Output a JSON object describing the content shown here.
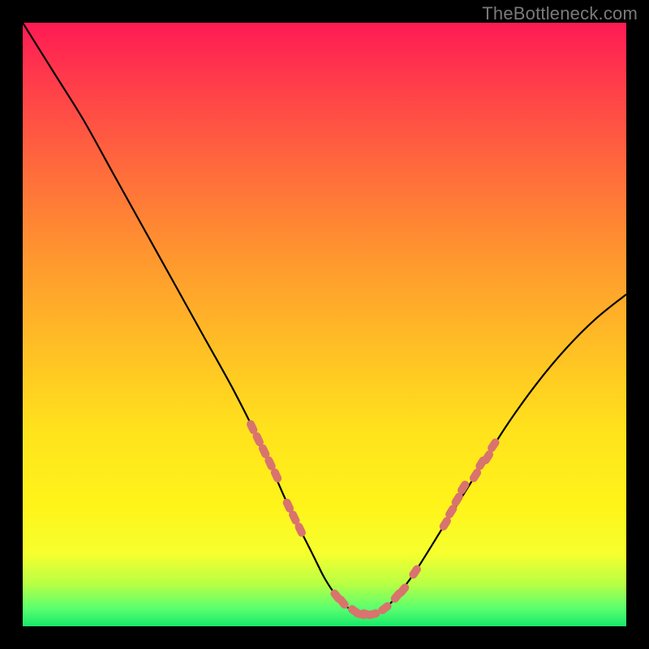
{
  "watermark": {
    "text": "TheBottleneck.com"
  },
  "colors": {
    "frame": "#000000",
    "curve": "#000000",
    "marker": "#d9736e",
    "gradient_top": "#ff1a54",
    "gradient_mid": "#ffe31c",
    "gradient_bottom": "#18e86a"
  },
  "chart_data": {
    "type": "line",
    "title": "",
    "xlabel": "",
    "ylabel": "",
    "xlim": [
      0,
      100
    ],
    "ylim": [
      0,
      100
    ],
    "grid": false,
    "legend": false,
    "series": [
      {
        "name": "bottleneck-curve",
        "x": [
          0,
          5,
          10,
          15,
          20,
          25,
          30,
          35,
          40,
          44,
          48,
          50,
          52,
          54,
          56,
          58,
          60,
          62,
          65,
          70,
          75,
          80,
          85,
          90,
          95,
          100
        ],
        "values": [
          100,
          92,
          84,
          75,
          66,
          57,
          48,
          39,
          29,
          20,
          12,
          8,
          5,
          3,
          2,
          2,
          3,
          5,
          9,
          17,
          25,
          33,
          40,
          46,
          51,
          55
        ]
      }
    ],
    "markers": [
      {
        "x": 38,
        "y": 33
      },
      {
        "x": 39,
        "y": 31
      },
      {
        "x": 40,
        "y": 29
      },
      {
        "x": 41,
        "y": 27
      },
      {
        "x": 42,
        "y": 25
      },
      {
        "x": 44,
        "y": 20
      },
      {
        "x": 45,
        "y": 18
      },
      {
        "x": 46,
        "y": 16
      },
      {
        "x": 52,
        "y": 5
      },
      {
        "x": 53,
        "y": 4
      },
      {
        "x": 55,
        "y": 2.5
      },
      {
        "x": 56,
        "y": 2
      },
      {
        "x": 57,
        "y": 2
      },
      {
        "x": 58,
        "y": 2
      },
      {
        "x": 60,
        "y": 3
      },
      {
        "x": 62,
        "y": 5
      },
      {
        "x": 63,
        "y": 6
      },
      {
        "x": 65,
        "y": 9
      },
      {
        "x": 70,
        "y": 17
      },
      {
        "x": 71,
        "y": 19
      },
      {
        "x": 72,
        "y": 21
      },
      {
        "x": 73,
        "y": 23
      },
      {
        "x": 75,
        "y": 25
      },
      {
        "x": 76,
        "y": 27
      },
      {
        "x": 77,
        "y": 28
      },
      {
        "x": 78,
        "y": 30
      }
    ]
  }
}
